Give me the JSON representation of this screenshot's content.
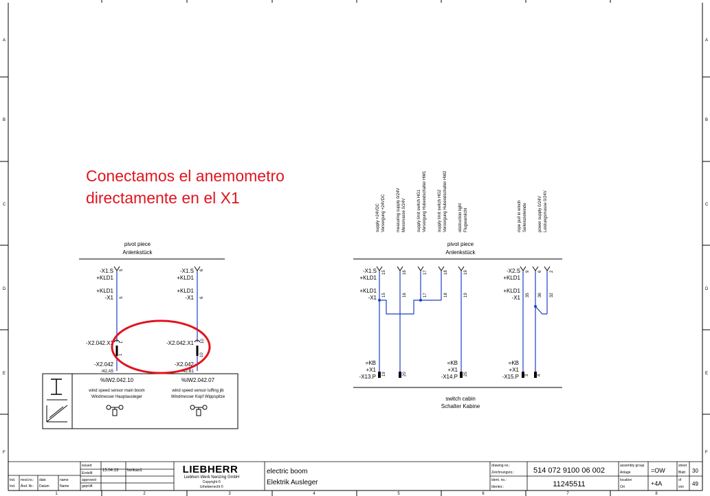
{
  "frame": {
    "row_letters": [
      "A",
      "B",
      "C",
      "D",
      "E",
      "F"
    ],
    "column_numbers": [
      "1",
      "2",
      "3",
      "4",
      "5",
      "6",
      "7",
      "8"
    ]
  },
  "annotation": {
    "line1": "Conectamos el anemometro",
    "line2": "directamente en el X1"
  },
  "pivot_left": {
    "title_en": "pivot piece",
    "title_de": "Anlenkstück",
    "sensor_a": {
      "top_conn": "-X1.S",
      "top_kld": "+KLD1",
      "top_pin": "5",
      "mid_kld": "+KLD1",
      "mid_conn": "-X1",
      "mid_pin": "5",
      "low_conn": "-X2.042.X1",
      "low_pin_top": "1",
      "low_pin_bot": "1",
      "bot_conn": "-X2.042",
      "bot_ref": "/42.A5",
      "id": "%IW2.042.10",
      "desc_en": "wind speed sensor main boom",
      "desc_de": "Windmesser Hauptausleger"
    },
    "sensor_b": {
      "top_conn": "-X1.S",
      "top_kld": "+KLD1",
      "top_pin": "6",
      "mid_kld": "+KLD1",
      "mid_conn": "-X1",
      "mid_pin": "6",
      "low_conn": "-X2.042.X1",
      "low_pin_top": "10",
      "low_pin_bot": "10",
      "bot_conn": "-X2.042",
      "bot_ref": "/42.B1",
      "id": "%IW2.042.07",
      "desc_en": "wind speed sensor luffing jib",
      "desc_de": "Windmesser Kopf Wippspitze"
    }
  },
  "pivot_right": {
    "title_en": "pivot piece",
    "title_de": "Anlenkstück",
    "supply_labels": [
      {
        "en": "supply +24VDC",
        "de": "Versorgung +24VDC"
      },
      {
        "en": "measuring supply 0/24V",
        "de": "Messmasse 0/24V"
      },
      {
        "en": "supply limit switch HG1",
        "de": "Versorgung Hubendschalter HW1"
      },
      {
        "en": "supply limit switch HG2",
        "de": "Versorgung Hubendschalter HW2"
      },
      {
        "en": "obstruction light",
        "de": "Flugwarnlicht"
      },
      {
        "en": "rope pull in winch",
        "de": "Seileinzielwinde"
      },
      {
        "en": "power supply 0/24V",
        "de": "Leistungsmasse 0/24V"
      }
    ],
    "group1": {
      "top_conn": "-X1.S",
      "top_kld": "+KLD1",
      "mid_kld": "+KLD1",
      "mid_conn": "-X1",
      "top_pins": [
        "15",
        "16",
        "17",
        "18",
        "19"
      ],
      "mid_pins": [
        "15",
        "16",
        "17",
        "18",
        "19"
      ],
      "kb_a": "=KB",
      "x1_a": "+X1",
      "term_a": "-X13.P",
      "bot_pins_a": [
        "19",
        "20"
      ],
      "kb_b": "=KB",
      "x1_b": "+X1",
      "term_b": "-X14.P",
      "bot_pin_b": "25"
    },
    "group2": {
      "top_conn": "-X2.S",
      "top_kld": "+KLD1",
      "mid_kld": "+KLD1",
      "mid_conn": "-X1",
      "top_pins": [
        "9",
        "6",
        "2"
      ],
      "mid_pins": [
        "35",
        "36",
        "32"
      ],
      "kb": "=KB",
      "x1": "+X1",
      "term": "-X15.P",
      "bot_pins": [
        "3",
        "4"
      ]
    },
    "cabin_en": "switch cabin",
    "cabin_de": "Schalter Kabine"
  },
  "title_block": {
    "issued_en": "issued",
    "issued_de": "Erstellt",
    "issued_date": "15.04.13",
    "issued_by": "lwnkas1",
    "approved_en": "approved",
    "approved_de": "geprüft",
    "ind": "Ind.",
    "mod_no": "mod.no.:",
    "mod_no_de": "Änd. Nr.:",
    "date": "date",
    "date_de": "Datum",
    "name": "name",
    "name_de": "Name",
    "brand": "LIEBHERR",
    "company": "Liebherr-Werk Nenzing GmbH",
    "copyright": "Copyright ©",
    "copyright_de": "Urheberrecht ©",
    "desc_en": "electric boom",
    "desc_de": "Elektrik Ausleger",
    "drawing_no_label": "drawing no.:",
    "drawing_no_label_de": "Zeichnungsnr.:",
    "drawing_no": "514 072 9100 06 002",
    "ident_label": "ident. no.:",
    "ident_label_de": "Identnr.:",
    "ident_no": "11245511",
    "assembly_label": "assembly group",
    "assembly_label_de": "Anlage",
    "assembly": "=OW",
    "location_label": "location",
    "location_label_de": "Ort",
    "location": "+4A",
    "sheet_label": "sheet",
    "sheet_label_de": "Blatt",
    "sheet": "30",
    "of_label": "of",
    "of_label_de": "von",
    "of": "49"
  },
  "colors": {
    "wire": "#1c3cc8",
    "annotation": "#e0141e",
    "ink": "#000000"
  }
}
